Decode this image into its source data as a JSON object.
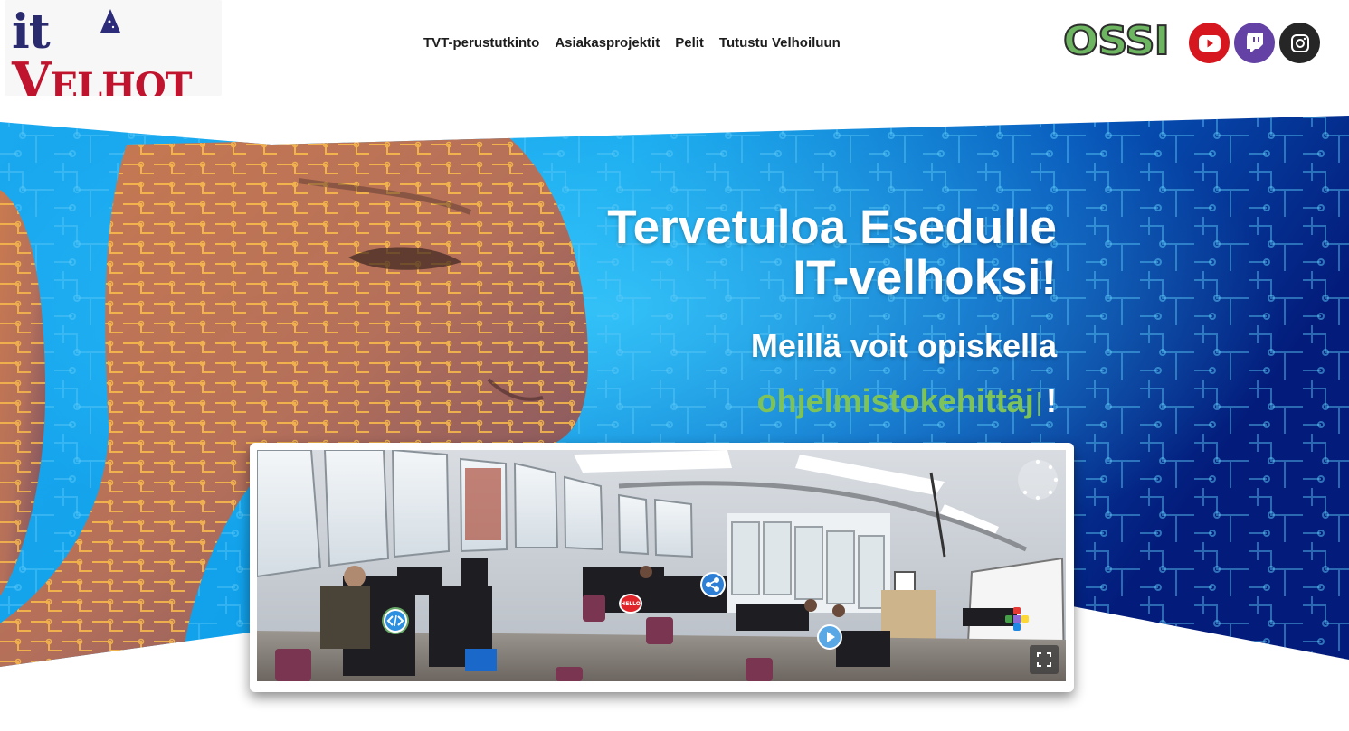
{
  "header": {
    "logo": {
      "it": "it",
      "velhot_main": "V",
      "velhot_e": "E",
      "velhot_rest": "LHOT"
    },
    "nav": [
      {
        "label": "TVT-perustutkinto"
      },
      {
        "label": "Asiakasprojektit"
      },
      {
        "label": "Pelit"
      },
      {
        "label": "Tutustu Velhoiluun"
      }
    ],
    "ossi_logo": "OSSI",
    "social": [
      {
        "icon": "youtube-icon",
        "color": "#d6171f"
      },
      {
        "icon": "twitch-icon",
        "color": "#6441a5"
      },
      {
        "icon": "instagram-icon",
        "color": "#262626"
      }
    ]
  },
  "hero": {
    "title_line1": "Tervetuloa Esedulle",
    "title_line2": "IT-velhoksi!",
    "subtitle": "Meillä voit opiskella",
    "typed_word": "ohjelmistokehittäjä",
    "typed_visible": "ohjelmistokehittäj",
    "typed_cursor": "|",
    "typed_suffix": "!",
    "accent_color": "#7dc35a"
  },
  "viewer": {
    "hotspots": [
      {
        "icon": "code-icon"
      },
      {
        "icon": "share-icon"
      },
      {
        "icon": "play-icon"
      },
      {
        "icon": "hello-sign-icon",
        "label": "HELLO"
      },
      {
        "icon": "puzzle-icon"
      }
    ],
    "fullscreen_icon": "fullscreen-icon",
    "loading_icon": "loading-spinner-icon"
  }
}
